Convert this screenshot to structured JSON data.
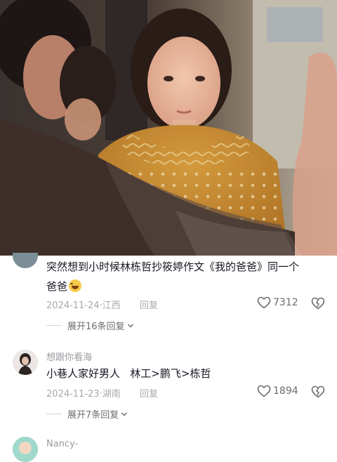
{
  "comments": [
    {
      "text_line1": "突然想到小时候林栋哲抄筱婷作文《我的爸爸》同一个",
      "text_line2": "爸爸",
      "date": "2024-11-24",
      "location": "江西",
      "reply_label": "回复",
      "likes": "7312",
      "expand_label": "展开16条回复"
    },
    {
      "username": "想跟你看海",
      "text": "小巷人家好男人   林工>鹏飞>栋哲",
      "date": "2024-11-23",
      "location": "湖南",
      "reply_label": "回复",
      "likes": "1894",
      "expand_label": "展开7条回复"
    },
    {
      "username": "Nancy-"
    }
  ],
  "colors": {
    "text": "#161823",
    "muted": "#a8a9ad",
    "sweater": "#c8892e"
  },
  "icons": [
    "heart-outline-icon",
    "broken-heart-icon",
    "chevron-down-icon",
    "laugh-cry-emoji"
  ]
}
